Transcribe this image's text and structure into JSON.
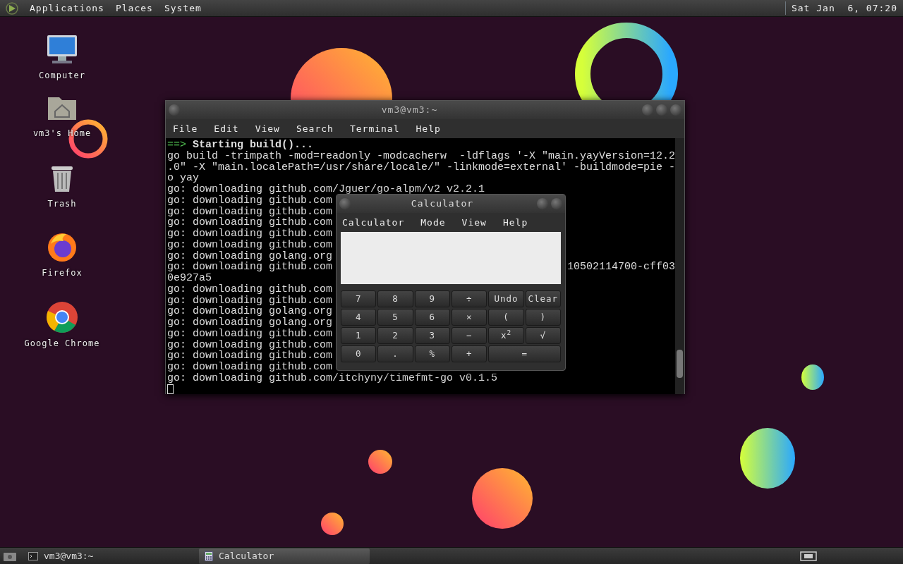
{
  "top_panel": {
    "menus": [
      "Applications",
      "Places",
      "System"
    ],
    "clock": "Sat Jan  6, 07:20"
  },
  "desktop_icons": [
    {
      "kind": "computer",
      "label": "Computer"
    },
    {
      "kind": "home",
      "label": "vm3's Home"
    },
    {
      "kind": "trash",
      "label": "Trash"
    },
    {
      "kind": "firefox",
      "label": "Firefox"
    },
    {
      "kind": "chrome",
      "label": "Google Chrome"
    }
  ],
  "terminal": {
    "title": "vm3@vm3:~",
    "menu": [
      "File",
      "Edit",
      "View",
      "Search",
      "Terminal",
      "Help"
    ],
    "lines": [
      {
        "prompt": "==>",
        "text": "Starting build()..."
      },
      {
        "text": "go build -trimpath -mod=readonly -modcacherw  -ldflags '-X \"main.yayVersion=12.2"
      },
      {
        "text": ".0\" -X \"main.localePath=/usr/share/locale/\" -linkmode=external' -buildmode=pie -"
      },
      {
        "text": "o yay"
      },
      {
        "text": "go: downloading github.com/Jguer/go-alpm/v2 v2.2.1"
      },
      {
        "text": "go: downloading github.com"
      },
      {
        "text": "go: downloading github.com"
      },
      {
        "text": "go: downloading github.com"
      },
      {
        "text": "go: downloading github.com"
      },
      {
        "text": "go: downloading github.com"
      },
      {
        "text": "go: downloading golang.org"
      },
      {
        "text": "go: downloading github.com",
        "tail": "10502114700-cff03"
      },
      {
        "text": "0e927a5"
      },
      {
        "text": "go: downloading github.com"
      },
      {
        "text": "go: downloading github.com"
      },
      {
        "text": "go: downloading golang.org"
      },
      {
        "text": "go: downloading golang.org"
      },
      {
        "text": "go: downloading github.com"
      },
      {
        "text": "go: downloading github.com"
      },
      {
        "text": "go: downloading github.com"
      },
      {
        "text": "go: downloading github.com"
      },
      {
        "text": "go: downloading github.com/itchyny/timefmt-go v0.1.5"
      }
    ]
  },
  "calculator": {
    "title": "Calculator",
    "menu": [
      "Calculator",
      "Mode",
      "View",
      "Help"
    ],
    "keys": [
      {
        "label": "7"
      },
      {
        "label": "8"
      },
      {
        "label": "9"
      },
      {
        "label": "÷"
      },
      {
        "label": "Undo"
      },
      {
        "label": "Clear"
      },
      {
        "label": "4"
      },
      {
        "label": "5"
      },
      {
        "label": "6"
      },
      {
        "label": "×"
      },
      {
        "label": "("
      },
      {
        "label": ")"
      },
      {
        "label": "1"
      },
      {
        "label": "2"
      },
      {
        "label": "3"
      },
      {
        "label": "−"
      },
      {
        "label": "x$^{2}$"
      },
      {
        "label": "√"
      },
      {
        "label": "0"
      },
      {
        "label": "."
      },
      {
        "label": "%"
      },
      {
        "label": "+"
      },
      {
        "label": "=",
        "wide": true
      }
    ]
  },
  "taskbar": {
    "items": [
      {
        "kind": "terminal",
        "label": "vm3@vm3:~",
        "selected": false
      },
      {
        "kind": "calculator",
        "label": "Calculator",
        "selected": true
      }
    ]
  }
}
